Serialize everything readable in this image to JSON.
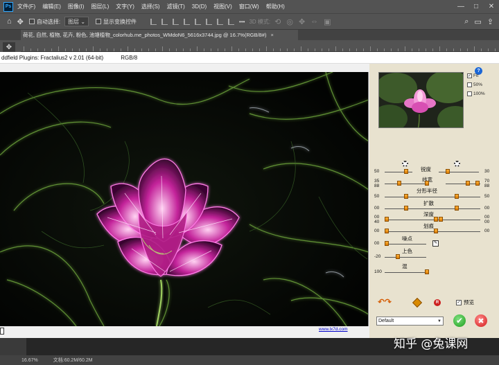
{
  "app": {
    "logo": "Ps",
    "menu": [
      "文件(F)",
      "编辑(E)",
      "图像(I)",
      "图层(L)",
      "文字(Y)",
      "选择(S)",
      "滤镜(T)",
      "3D(D)",
      "视图(V)",
      "窗口(W)",
      "帮助(H)"
    ],
    "window_controls": [
      "—",
      "□",
      "✕"
    ]
  },
  "options_bar": {
    "auto_select_label": "自动选择:",
    "auto_select_value": "图层",
    "show_transform_label": "显示变换控件",
    "more_label": "•••",
    "mode_3d_label": "3D 模式:"
  },
  "document": {
    "tab_title": "荷花, 自然, 植物, 花卉, 粉色, 池塘植物_colorhub.me_photos_WMdoN6_5616x3744.jpg @ 16.7%(RGB/8#)",
    "tab_close": "×"
  },
  "plugin": {
    "title": "ddfield Plugins: Fractalius2 v 2.01 (64-bit)",
    "mode": "RGB/8",
    "help": "?",
    "zoom_options": [
      {
        "label": "Fit",
        "checked": true
      },
      {
        "label": "50%",
        "checked": false
      },
      {
        "label": "100%",
        "checked": false
      }
    ],
    "sliders": [
      {
        "label": "锐度",
        "left": "50",
        "right": "30"
      },
      {
        "label": "线宽",
        "left": "35",
        "left2": "88",
        "right": "70",
        "right2": "88"
      },
      {
        "label": "分形半径",
        "left": "50",
        "right": "50"
      },
      {
        "label": "扩散",
        "left": "00",
        "right": "00"
      },
      {
        "label": "深度",
        "left": "00",
        "left2": "40",
        "right": "00",
        "right2": "00"
      },
      {
        "label": "划痕",
        "left": "00",
        "right": "00"
      },
      {
        "label": "噪点",
        "left": "00"
      },
      {
        "label": "上色",
        "left": "-20"
      },
      {
        "label": "混",
        "left": "100"
      }
    ],
    "preview_toggle_label": "预览",
    "preview_checked": true,
    "reset_label": "R",
    "preset_value": "Default",
    "ok_label": "✔",
    "cancel_label": "✖",
    "link_text": "www.lx7d.com"
  },
  "status": {
    "zoom": "16.67%",
    "doc": "文档:60.2M/60.2M"
  },
  "watermark": "知乎 @兔课网",
  "colors": {
    "petal_glow": "#ff4fd8",
    "leaf_glow": "#8fd14f",
    "ok_green": "#1b9d1b",
    "cancel_red": "#d11a1a",
    "knob_orange": "#f29a10"
  }
}
